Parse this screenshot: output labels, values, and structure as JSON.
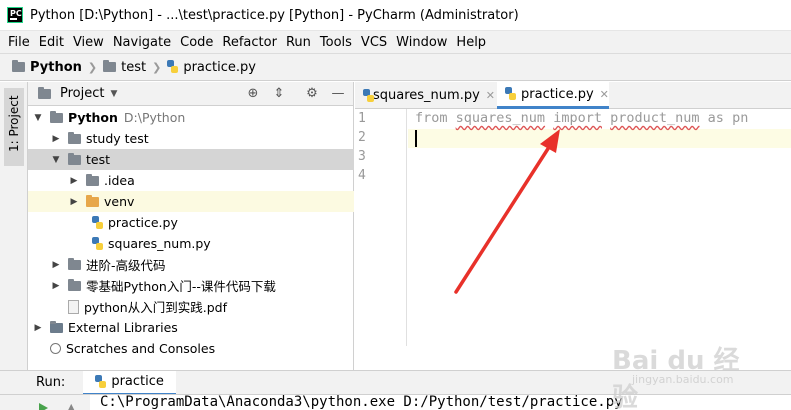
{
  "window": {
    "title": "Python [D:\\Python] - ...\\test\\practice.py [Python] - PyCharm (Administrator)",
    "app_icon_text": "PC"
  },
  "menu": [
    "File",
    "Edit",
    "View",
    "Navigate",
    "Code",
    "Refactor",
    "Run",
    "Tools",
    "VCS",
    "Window",
    "Help"
  ],
  "breadcrumb": [
    "Python",
    "test",
    "practice.py"
  ],
  "side_tab": {
    "label": "1: Project"
  },
  "project_panel": {
    "title": "Project",
    "root": {
      "name": "Python",
      "path": "D:\\Python"
    },
    "items": [
      {
        "label": "study test",
        "type": "folder"
      },
      {
        "label": "test",
        "type": "folder"
      },
      {
        "label": ".idea",
        "type": "folder"
      },
      {
        "label": "venv",
        "type": "folder-orange"
      },
      {
        "label": "practice.py",
        "type": "python"
      },
      {
        "label": "squares_num.py",
        "type": "python"
      },
      {
        "label": "进阶-高级代码",
        "type": "folder"
      },
      {
        "label": "零基础Python入门--课件代码下载",
        "type": "folder"
      },
      {
        "label": "python从入门到实践.pdf",
        "type": "pdf"
      },
      {
        "label": "External Libraries",
        "type": "library"
      },
      {
        "label": "Scratches and Consoles",
        "type": "scratch"
      }
    ]
  },
  "editor": {
    "tabs": [
      {
        "label": "squares_num.py",
        "active": false
      },
      {
        "label": "practice.py",
        "active": true
      }
    ],
    "line_numbers": [
      "1",
      "2",
      "3",
      "4"
    ],
    "code": {
      "kw_from": "from",
      "module": "squares_num",
      "kw_import": "import",
      "name": "product_num",
      "kw_as": "as",
      "alias": "pn"
    }
  },
  "run": {
    "label": "Run:",
    "tab": "practice",
    "console_line": "C:\\ProgramData\\Anaconda3\\python.exe D:/Python/test/practice.py"
  },
  "watermark": {
    "text": "Bai du 经验",
    "url": "jingyan.baidu.com"
  },
  "colors": {
    "accent": "#4083c9",
    "annotation_arrow": "#e8312a",
    "folder": "#7f8790",
    "folder_excluded": "#e7a74a"
  }
}
